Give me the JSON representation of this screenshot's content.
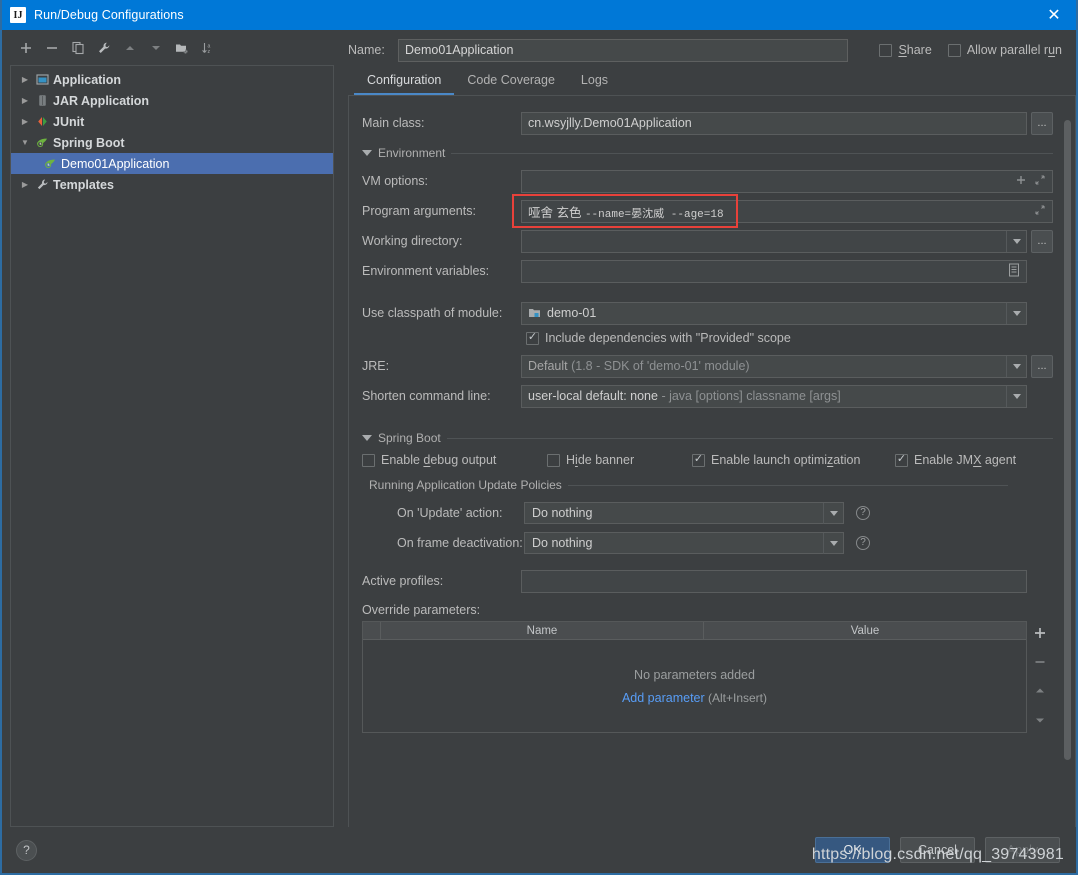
{
  "window": {
    "title": "Run/Debug Configurations",
    "app_icon_text": "IJ",
    "close_label": "✕",
    "accent_color": "#0078d7",
    "background_color": "#3c3f41",
    "selection_color": "#4b6eaf",
    "link_color": "#589df6",
    "highlight_color": "#e8413a"
  },
  "toolbar": {
    "items": [
      {
        "name": "add-button",
        "icon": "plus-icon",
        "title": "Add New Configuration"
      },
      {
        "name": "remove-button",
        "icon": "minus-icon",
        "title": "Remove Configuration"
      },
      {
        "name": "copy-button",
        "icon": "copy-icon",
        "title": "Copy Configuration"
      },
      {
        "name": "edit-templates-button",
        "icon": "wrench-icon",
        "title": "Edit Templates"
      },
      {
        "name": "move-up-button",
        "icon": "arrow-up-icon",
        "title": "Move Up"
      },
      {
        "name": "move-down-button",
        "icon": "arrow-down-icon",
        "title": "Move Down"
      },
      {
        "name": "move-into-folder-button",
        "icon": "folder-add-icon",
        "title": "Create New Folder"
      },
      {
        "name": "sort-button",
        "icon": "sort-az-icon",
        "title": "Sort Configurations"
      }
    ]
  },
  "tree": {
    "items": [
      {
        "label": "Application",
        "icon": "application-icon",
        "expandable": true,
        "expanded": false,
        "level": 0,
        "selected": false
      },
      {
        "label": "JAR Application",
        "icon": "jar-icon",
        "expandable": true,
        "expanded": false,
        "level": 0,
        "selected": false
      },
      {
        "label": "JUnit",
        "icon": "junit-icon",
        "expandable": true,
        "expanded": false,
        "level": 0,
        "selected": false
      },
      {
        "label": "Spring Boot",
        "icon": "spring-boot-icon",
        "expandable": true,
        "expanded": true,
        "level": 0,
        "selected": false
      },
      {
        "label": "Demo01Application",
        "icon": "spring-boot-icon",
        "expandable": false,
        "expanded": false,
        "level": 1,
        "selected": true
      },
      {
        "label": "Templates",
        "icon": "wrench-icon",
        "expandable": true,
        "expanded": false,
        "level": 0,
        "selected": false
      }
    ]
  },
  "name_row": {
    "label": "Name:",
    "value": "Demo01Application",
    "placeholder": "",
    "share_label": "Share",
    "share_checked": false,
    "allow_parallel_label": "Allow parallel run",
    "allow_parallel_checked": false
  },
  "tabs": [
    {
      "label": "Configuration",
      "active": true
    },
    {
      "label": "Code Coverage",
      "active": false
    },
    {
      "label": "Logs",
      "active": false
    }
  ],
  "form": {
    "main_class": {
      "label": "Main class:",
      "value": "cn.wsyjlly.Demo01Application",
      "browse_label": "..."
    },
    "environment_section": {
      "label": "Environment",
      "expanded": true
    },
    "vm_options": {
      "label": "VM options:",
      "value": "",
      "placeholder": ""
    },
    "program_arguments": {
      "label": "Program arguments:",
      "value_part1": "哑舍 玄色 ",
      "value_part2": "--name=晏沈威 ",
      "value_part3": "--age=18",
      "full_value": "哑舍 玄色 --name=晏沈威 --age=18",
      "highlighted": true
    },
    "working_directory": {
      "label": "Working directory:",
      "value": "",
      "browse_label": "..."
    },
    "environment_variables": {
      "label": "Environment variables:",
      "value": ""
    },
    "use_classpath": {
      "label": "Use classpath of module:",
      "value": "demo-01"
    },
    "include_provided": {
      "label": "Include dependencies with \"Provided\" scope",
      "checked": true
    },
    "jre": {
      "label": "JRE:",
      "value": "Default",
      "value_hint": "(1.8 - SDK of 'demo-01' module)",
      "browse_label": "..."
    },
    "shorten_command_line": {
      "label": "Shorten command line:",
      "value": "user-local default: none",
      "value_hint": "- java [options] classname [args]"
    },
    "spring_boot_section": {
      "label": "Spring Boot",
      "expanded": true
    },
    "spring_checks": [
      {
        "label_pre": "Enable ",
        "label_key": "d",
        "label_post": "ebug output",
        "checked": false,
        "name": "enable-debug-output"
      },
      {
        "label_pre": "H",
        "label_key": "i",
        "label_post": "de banner",
        "checked": false,
        "name": "hide-banner"
      },
      {
        "label_pre": "Enable launch optimi",
        "label_key": "z",
        "label_post": "ation",
        "checked": true,
        "name": "enable-launch-optimization"
      },
      {
        "label_pre": "Enable JM",
        "label_key": "X",
        "label_post": " agent",
        "checked": true,
        "name": "enable-jmx-agent"
      }
    ],
    "update_policies_section": {
      "label": "Running Application Update Policies"
    },
    "on_update_action": {
      "label": "On 'Update' action:",
      "value": "Do nothing",
      "help": "?"
    },
    "on_frame_deactivation": {
      "label": "On frame deactivation:",
      "value": "Do nothing",
      "help": "?"
    },
    "active_profiles": {
      "label": "Active profiles:",
      "value": ""
    },
    "override_parameters": {
      "label": "Override parameters:",
      "columns": [
        "",
        "Name",
        "Value"
      ],
      "rows": [],
      "empty_text": "No parameters added",
      "add_link": "Add parameter",
      "add_hint": " (Alt+Insert)",
      "side_buttons": [
        "add-row-button",
        "remove-row-button",
        "move-row-up-button",
        "move-row-down-button"
      ]
    }
  },
  "footer": {
    "help_label": "?",
    "buttons": [
      {
        "label": "OK",
        "style": "primary",
        "name": "ok-button"
      },
      {
        "label": "Cancel",
        "style": "default",
        "name": "cancel-button"
      },
      {
        "label": "Apply",
        "style": "disabled",
        "name": "apply-button"
      }
    ],
    "watermark": "https://blog.csdn.net/qq_39743981"
  }
}
